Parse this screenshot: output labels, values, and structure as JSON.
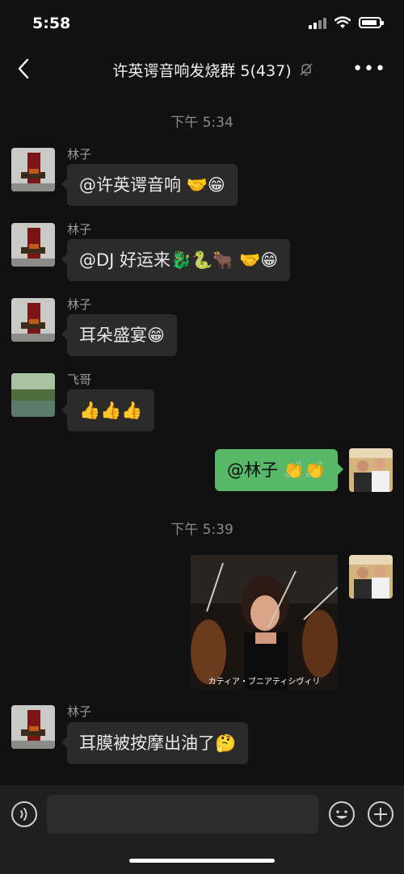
{
  "status": {
    "time": "5:58"
  },
  "nav": {
    "title": "许英谔音响发烧群 5(437)",
    "more": "•••"
  },
  "timestamps": [
    "下午 5:34",
    "下午 5:39"
  ],
  "messages": [
    {
      "sender": "林子",
      "text": "@许英谔音响 🤝😁"
    },
    {
      "sender": "林子",
      "text": "@DJ 好运来🐉🐍🐂 🤝😁"
    },
    {
      "sender": "林子",
      "text": "耳朵盛宴😁"
    },
    {
      "sender": "飞哥",
      "text": "👍👍👍"
    },
    {
      "text": "@林子 👏👏"
    },
    {
      "image_caption": "カティア・ブニアティシヴィリ"
    },
    {
      "sender": "林子",
      "text": "耳膜被按摩出油了🤔"
    }
  ],
  "icons": {
    "back": "chevron-left-icon",
    "mute": "bell-muted-icon",
    "voice": "voice-icon",
    "emoji": "emoji-icon",
    "add": "plus-icon"
  },
  "colors": {
    "background": "#111111",
    "bubble_in": "#2b2b2b",
    "bubble_out": "#57b868",
    "input_bar": "#1f1f1f"
  }
}
